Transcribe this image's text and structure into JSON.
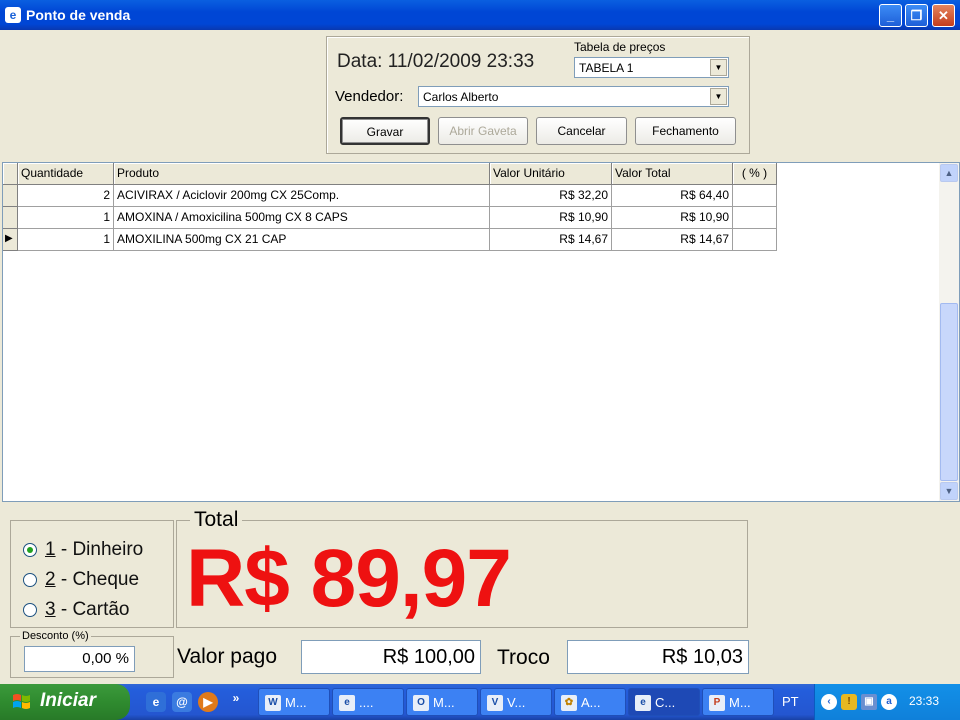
{
  "window": {
    "title": "Ponto de venda",
    "minimize_label": "_",
    "maximize_label": "❐",
    "close_label": "✕"
  },
  "header": {
    "date_label": "Data: 11/02/2009 23:33",
    "price_table_label": "Tabela de preços",
    "price_table_value": "TABELA 1",
    "seller_label": "Vendedor:",
    "seller_value": "Carlos Alberto"
  },
  "buttons": {
    "save": "Gravar",
    "open_drawer": "Abrir Gaveta",
    "cancel": "Cancelar",
    "close_sale": "Fechamento"
  },
  "grid": {
    "columns": [
      "Quantidade",
      "Produto",
      "Valor Unitário",
      "Valor Total",
      "( % )"
    ],
    "rows": [
      {
        "qty": "2",
        "product": "ACIVIRAX / Aciclovir 200mg CX 25Comp.",
        "unit": "R$ 32,20",
        "total": "R$ 64,40",
        "pct": ""
      },
      {
        "qty": "1",
        "product": "AMOXINA / Amoxicilina 500mg CX 8 CAPS",
        "unit": "R$ 10,90",
        "total": "R$ 10,90",
        "pct": ""
      },
      {
        "qty": "1",
        "product": "AMOXILINA 500mg  CX 21 CAP",
        "unit": "R$ 14,67",
        "total": "R$ 14,67",
        "pct": ""
      }
    ],
    "current_row_indicator": "▶"
  },
  "payment": {
    "options": [
      {
        "key": "1",
        "label": " - Dinheiro",
        "selected": true
      },
      {
        "key": "2",
        "label": " - Cheque",
        "selected": false
      },
      {
        "key": "3",
        "label": " - Cartão",
        "selected": false
      }
    ]
  },
  "total": {
    "legend": "Total",
    "value": "R$ 89,97",
    "color": "#EE1111"
  },
  "discount": {
    "legend": "Desconto (%)",
    "value": "0,00 %"
  },
  "paid": {
    "label": "Valor pago",
    "value": "R$ 100,00"
  },
  "change": {
    "label": "Troco",
    "value": "R$ 10,03"
  },
  "taskbar": {
    "start_label": "Iniciar",
    "overflow": "»",
    "tasks": [
      {
        "icon": "word-icon",
        "label": "M..."
      },
      {
        "icon": "ie-icon",
        "label": "...."
      },
      {
        "icon": "outlook-icon",
        "label": "M..."
      },
      {
        "icon": "vm-icon",
        "label": "V..."
      },
      {
        "icon": "app-icon",
        "label": "A..."
      },
      {
        "icon": "pos-icon",
        "label": "C..."
      },
      {
        "icon": "ppt-icon",
        "label": "M..."
      }
    ],
    "language": "PT",
    "clock": "23:33"
  }
}
